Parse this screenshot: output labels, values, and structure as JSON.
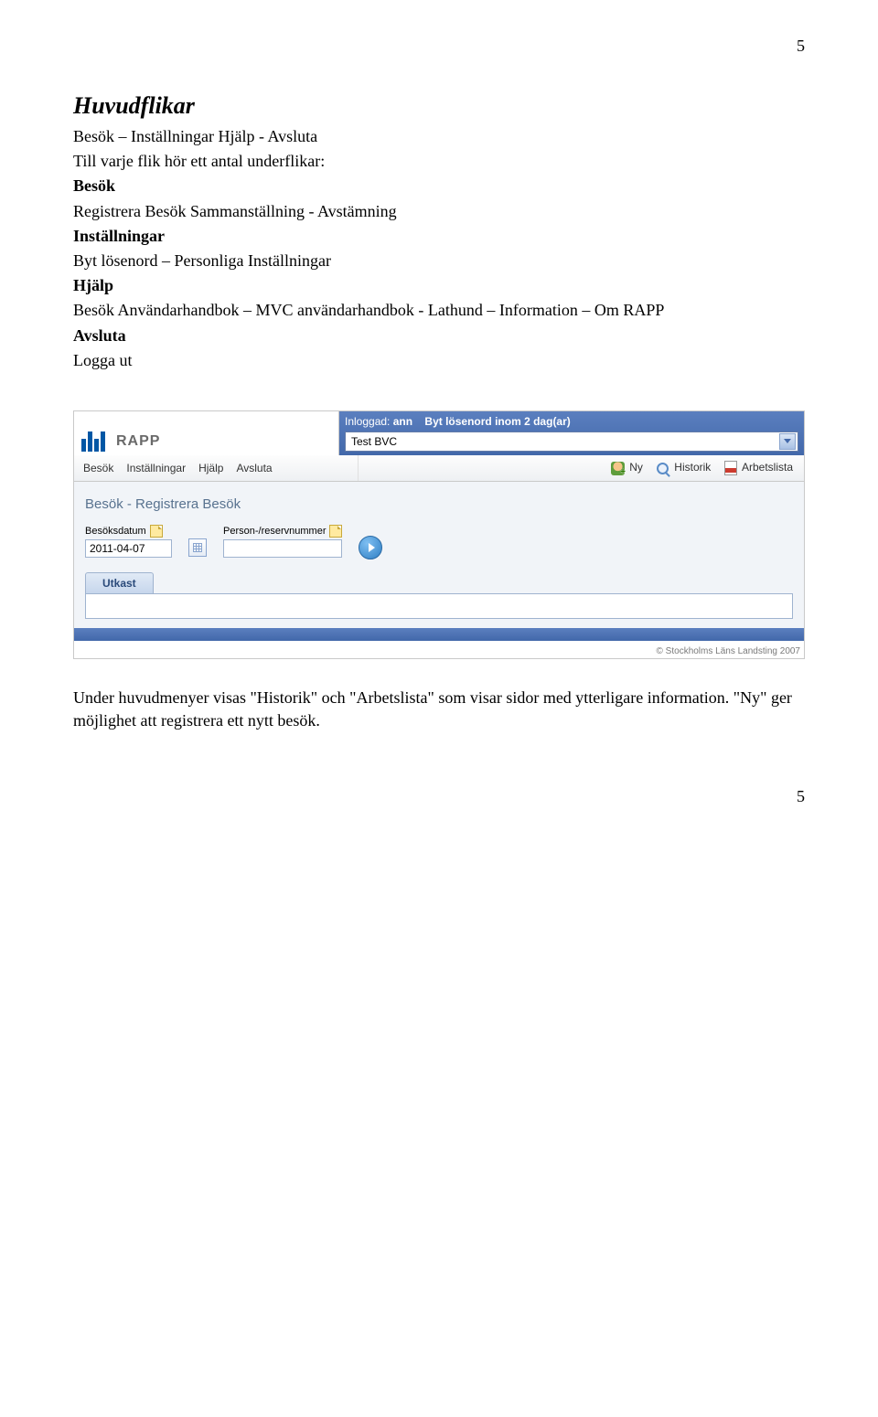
{
  "page_number_top": "5",
  "page_number_bottom": "5",
  "section_title": "Huvudflikar",
  "intro_line": "Besök – Inställningar Hjälp - Avsluta",
  "subhead_line": "Till varje flik hör ett antal underflikar:",
  "groups": {
    "besok": {
      "label": "Besök",
      "body": "Registrera Besök Sammanställning - Avstämning"
    },
    "installningar": {
      "label": "Inställningar",
      "body": "Byt lösenord – Personliga Inställningar"
    },
    "hjalp": {
      "label": "Hjälp",
      "body": "Besök Användarhandbok – MVC  användarhandbok - Lathund – Information – Om RAPP"
    },
    "avsluta": {
      "label": "Avsluta",
      "body": "Logga ut"
    }
  },
  "screenshot": {
    "logo_text": "RAPP",
    "login": {
      "label": "Inloggad:",
      "user": "ann",
      "warning": "Byt lösenord inom 2 dag(ar)"
    },
    "unit_selected": "Test BVC",
    "menu": [
      "Besök",
      "Inställningar",
      "Hjälp",
      "Avsluta"
    ],
    "actions": {
      "ny": "Ny",
      "historik": "Historik",
      "arbetslista": "Arbetslista"
    },
    "panel_title": "Besök - Registrera Besök",
    "fields": {
      "date_label": "Besöksdatum",
      "date_value": "2011-04-07",
      "pnr_label": "Person-/reservnummer",
      "pnr_value": ""
    },
    "subtab": "Utkast",
    "copyright": "© Stockholms Läns Landsting 2007"
  },
  "after_paragraph": "Under huvudmenyer visas \"Historik\" och \"Arbetslista\" som visar sidor med ytterligare information. \"Ny\" ger möjlighet att registrera ett nytt besök."
}
